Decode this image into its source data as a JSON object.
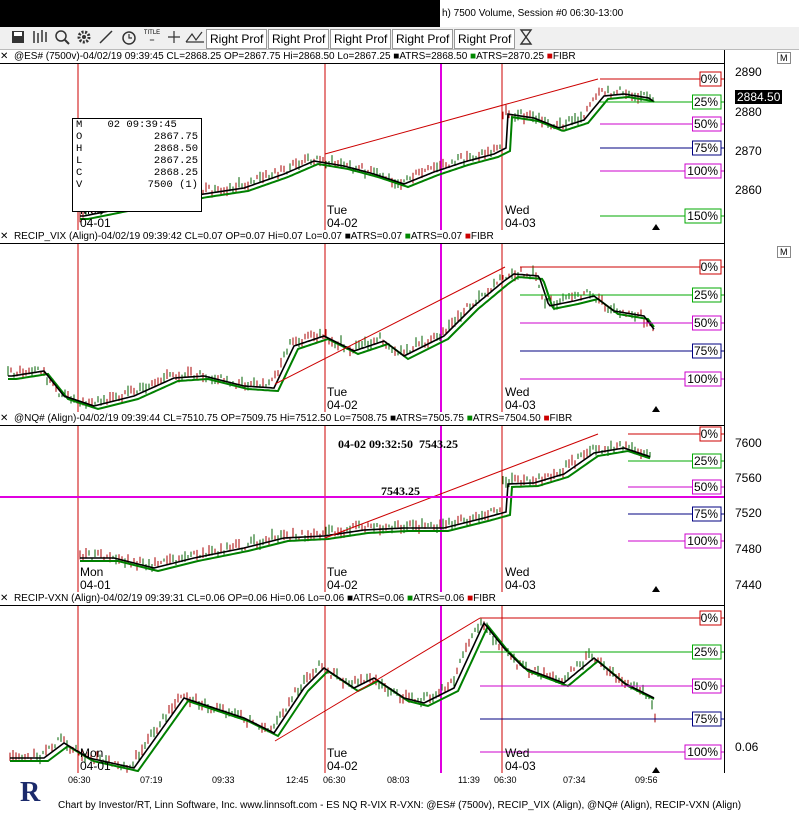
{
  "window": {
    "title_fragment": "h) 7500 Volume, Session #0 06:30-13:00"
  },
  "toolbar": {
    "right_prof_label": "Right Prof",
    "right_prof_count": 5,
    "tools": [
      "save-icon",
      "bars-icon",
      "zoom-icon",
      "gear-icon",
      "draw-line-icon",
      "alarm-clock-icon",
      "title-icon",
      "crosshair-icon",
      "measure-icon",
      "hourglass-icon"
    ],
    "title_tool_label": "TITLE"
  },
  "panes": [
    {
      "header": "@ES# (7500v)-04/02/19 09:39:45 CL=2868.25 OP=2867.75 Hi=2868.50 Lo=2867.25",
      "atrs1": "ATRS=2868.50",
      "atrs2": "ATRS=2870.25",
      "fibr": "FIBR",
      "y_ticks": [
        "2890",
        "2880",
        "2870",
        "2860"
      ],
      "last_price": "2884.50",
      "fib_levels": [
        "0%",
        "25%",
        "50%",
        "75%",
        "100%",
        "150%"
      ],
      "day_labels": [
        {
          "day": "Mon",
          "date": "04-01"
        },
        {
          "day": "Tue",
          "date": "04-02"
        },
        {
          "day": "Wed",
          "date": "04-03"
        }
      ],
      "data_window": {
        "time": "M    02 09:39:45",
        "rows": [
          [
            "O",
            "2867.75"
          ],
          [
            "H",
            "2868.50"
          ],
          [
            "L",
            "2867.25"
          ],
          [
            "C",
            "2868.25"
          ],
          [
            "V",
            "7500 (1)"
          ]
        ]
      }
    },
    {
      "header": "RECIP_VIX (Align)-04/02/19 09:39:42 CL=0.07 OP=0.07 Hi=0.07 Lo=0.07",
      "atrs1": "ATRS=0.07",
      "atrs2": "ATRS=0.07",
      "fibr": "FIBR",
      "fib_levels": [
        "0%",
        "25%",
        "50%",
        "75%",
        "100%"
      ],
      "day_labels": [
        {
          "day": "Tue",
          "date": "04-02"
        },
        {
          "day": "Wed",
          "date": "04-03"
        }
      ]
    },
    {
      "header": "@NQ# (Align)-04/02/19 09:39:44 CL=7510.75 OP=7509.75 Hi=7512.50 Lo=7508.75",
      "atrs1": "ATRS=7505.75",
      "atrs2": "ATRS=7504.50",
      "fibr": "FIBR",
      "y_ticks": [
        "7600",
        "7560",
        "7520",
        "7480",
        "7440"
      ],
      "crosshair_readout": "04-02 09:32:50  7543.25",
      "crosshair_price": "7543.25",
      "fib_levels": [
        "0%",
        "25%",
        "50%",
        "75%",
        "100%"
      ],
      "day_labels": [
        {
          "day": "Mon",
          "date": "04-01"
        },
        {
          "day": "Tue",
          "date": "04-02"
        },
        {
          "day": "Wed",
          "date": "04-03"
        }
      ]
    },
    {
      "header": "RECIP-VXN (Align)-04/02/19 09:39:31 CL=0.06 OP=0.06 Hi=0.06 Lo=0.06",
      "atrs1": "ATRS=0.06",
      "atrs2": "ATRS=0.06",
      "fibr": "FIBR",
      "y_ticks": [
        "0.06"
      ],
      "fib_levels": [
        "0%",
        "25%",
        "50%",
        "75%",
        "100%"
      ],
      "day_labels": [
        {
          "day": "Mon",
          "date": "04-01"
        },
        {
          "day": "Tue",
          "date": "04-02"
        },
        {
          "day": "Wed",
          "date": "04-03"
        }
      ]
    }
  ],
  "time_axis": [
    "06:30",
    "07:19",
    "09:33",
    "12:45",
    "06:30",
    "08:03",
    "11:39",
    "06:30",
    "07:34",
    "09:56"
  ],
  "footer": "Chart by Investor/RT, Linn Software, Inc. www.linnsoft.com - ES NQ R-VIX R-VXN: @ES# (7500v), RECIP_VIX (Align), @NQ# (Align), RECIP-VXN (Align)",
  "pane_button_label": "M",
  "colors": {
    "atrs1": "#000000",
    "atrs2": "#008000",
    "fibr": "#cc0000",
    "crosshair": "#e000e0",
    "session": "#cc0000"
  }
}
